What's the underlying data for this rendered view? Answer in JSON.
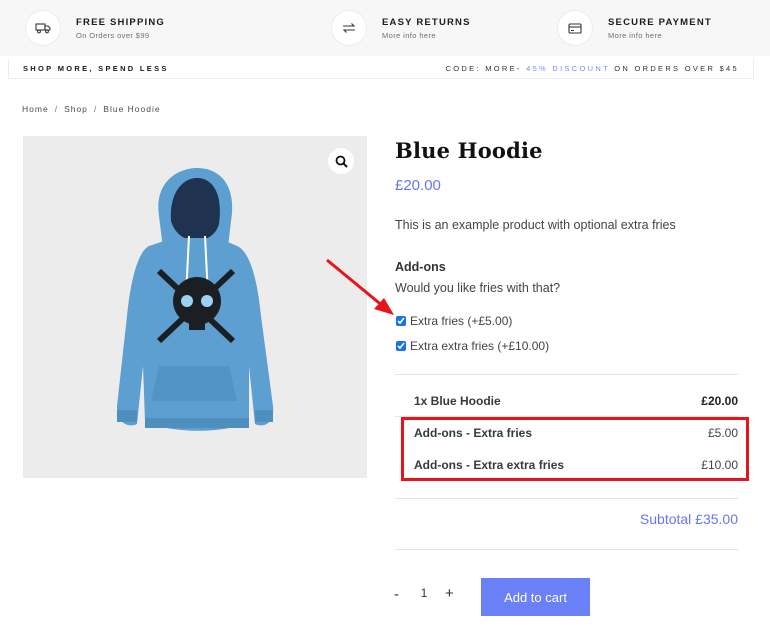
{
  "service_bar": {
    "shipping": {
      "title": "FREE SHIPPING",
      "subtitle": "On Orders over $99",
      "icon": "truck-icon"
    },
    "returns": {
      "title": "EASY RETURNS",
      "subtitle": "More info here",
      "icon": "swap-arrows-icon"
    },
    "payment": {
      "title": "SECURE PAYMENT",
      "subtitle": "More info here",
      "icon": "credit-card-icon"
    }
  },
  "promo": {
    "left": "SHOP MORE, SPEND LESS",
    "right_prefix": "CODE: MORE-",
    "right_accent": "45% DISCOUNT",
    "right_suffix": "ON ORDERS OVER $45"
  },
  "breadcrumb": [
    "Home",
    "Shop",
    "Blue Hoodie"
  ],
  "product": {
    "title": "Blue Hoodie",
    "price": "£20.00",
    "description": "This is an example product with optional extra fries"
  },
  "addons": {
    "heading": "Add-ons",
    "question": "Would you like fries with that?",
    "options": [
      {
        "label": "Extra fries (+£5.00)",
        "checked": true
      },
      {
        "label": "Extra extra fries (+£10.00)",
        "checked": true
      }
    ]
  },
  "totals": {
    "rows": [
      {
        "label": "1x Blue Hoodie",
        "value": "£20.00"
      },
      {
        "label": "Add-ons - Extra fries",
        "value": "£5.00"
      },
      {
        "label": "Add-ons - Extra extra fries",
        "value": "£10.00"
      }
    ],
    "subtotal": "Subtotal £35.00"
  },
  "cart": {
    "minus": "-",
    "quantity": "1",
    "plus": "+",
    "add_to_cart": "Add to cart"
  },
  "colors": {
    "accent": "#6478f0",
    "button": "#6a80f7",
    "highlight": "#e8131b",
    "hoodie": "#5c9fd0"
  }
}
